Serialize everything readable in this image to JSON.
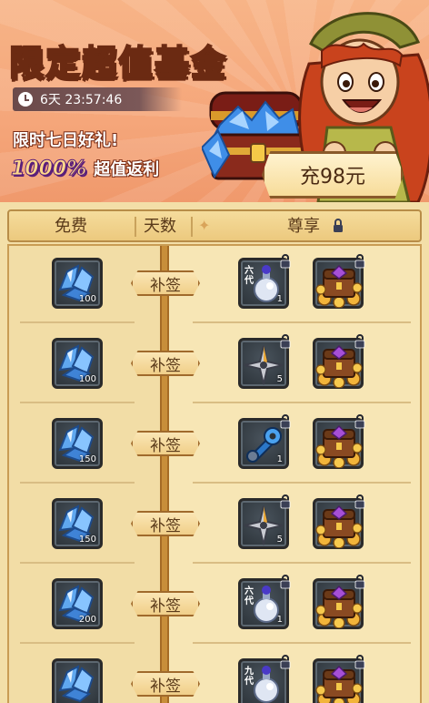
{
  "banner": {
    "title": "限定超值基金",
    "timer": "6天 23:57:46",
    "subtitle": "限时七日好礼!",
    "percent": "1000%",
    "rebate": "超值返利",
    "buy_label": "充98元"
  },
  "header": {
    "free": "免费",
    "day": "天数",
    "vip": "尊享"
  },
  "rows": [
    {
      "free_qty": "100",
      "sign_label": "补签",
      "vip1_qty": "1",
      "vip1_tag": "六代",
      "vip1_kind": "potion"
    },
    {
      "free_qty": "100",
      "sign_label": "补签",
      "vip1_qty": "5",
      "vip1_tag": "",
      "vip1_kind": "shuriken"
    },
    {
      "free_qty": "150",
      "sign_label": "补签",
      "vip1_qty": "1",
      "vip1_tag": "",
      "vip1_kind": "wrench"
    },
    {
      "free_qty": "150",
      "sign_label": "补签",
      "vip1_qty": "5",
      "vip1_tag": "",
      "vip1_kind": "shuriken"
    },
    {
      "free_qty": "200",
      "sign_label": "补签",
      "vip1_qty": "1",
      "vip1_tag": "六代",
      "vip1_kind": "potion"
    },
    {
      "free_qty": "",
      "sign_label": "补签",
      "vip1_qty": "",
      "vip1_tag": "九代",
      "vip1_kind": "potion"
    }
  ],
  "colors": {
    "banner_bg": "#f5a67a",
    "panel_bg": "#f3dfa8",
    "axis": "#c88e3a",
    "button_text": "#4b2b13"
  }
}
